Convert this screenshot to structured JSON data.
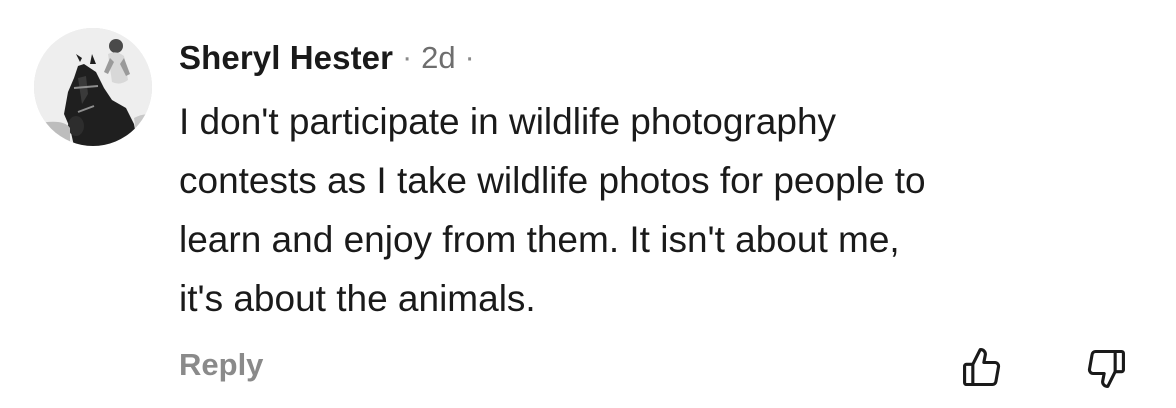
{
  "comment": {
    "author": "Sheryl Hester",
    "separator": "·",
    "time": "2d",
    "text_lines": [
      "I don't participate in wildlife photography",
      "contests as I take wildlife photos for people to",
      "learn and enjoy from them. It isn't about me,",
      "it's about the animals."
    ],
    "reply_label": "Reply"
  },
  "icons": {
    "upvote": "thumbs-up-icon",
    "downvote": "thumbs-down-icon"
  },
  "colors": {
    "text": "#1a1a1a",
    "muted": "#8a8a8a"
  }
}
